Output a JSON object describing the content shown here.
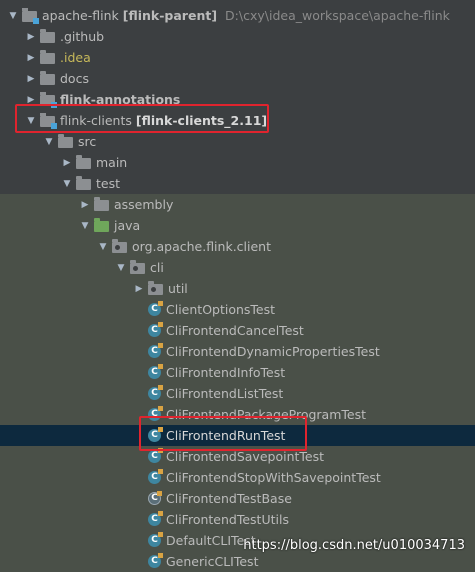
{
  "tree": {
    "root": {
      "name": "apache-flink",
      "module": "[flink-parent]",
      "path": "D:\\cxy\\idea_workspace\\apache-flink"
    },
    "github": ".github",
    "idea": ".idea",
    "docs": "docs",
    "annotations": "flink-annotations",
    "clients": {
      "name": "flink-clients",
      "module": "[flink-clients_2.11]"
    },
    "src": "src",
    "main": "main",
    "test": "test",
    "assembly": "assembly",
    "java": "java",
    "package": "org.apache.flink.client",
    "cli": "cli",
    "util": "util",
    "classes": [
      "ClientOptionsTest",
      "CliFrontendCancelTest",
      "CliFrontendDynamicPropertiesTest",
      "CliFrontendInfoTest",
      "CliFrontendListTest",
      "CliFrontendPackageProgramTest",
      "CliFrontendRunTest",
      "CliFrontendSavepointTest",
      "CliFrontendStopWithSavepointTest",
      "CliFrontendTestBase",
      "CliFrontendTestUtils",
      "DefaultCLITest",
      "GenericCLITest"
    ],
    "class_icon_letter": "C"
  },
  "watermark": "https://blog.csdn.net/u010034713",
  "colors": {
    "highlight": "#e0242e",
    "selection": "#0d293e",
    "test_bg": "#4a5048"
  }
}
